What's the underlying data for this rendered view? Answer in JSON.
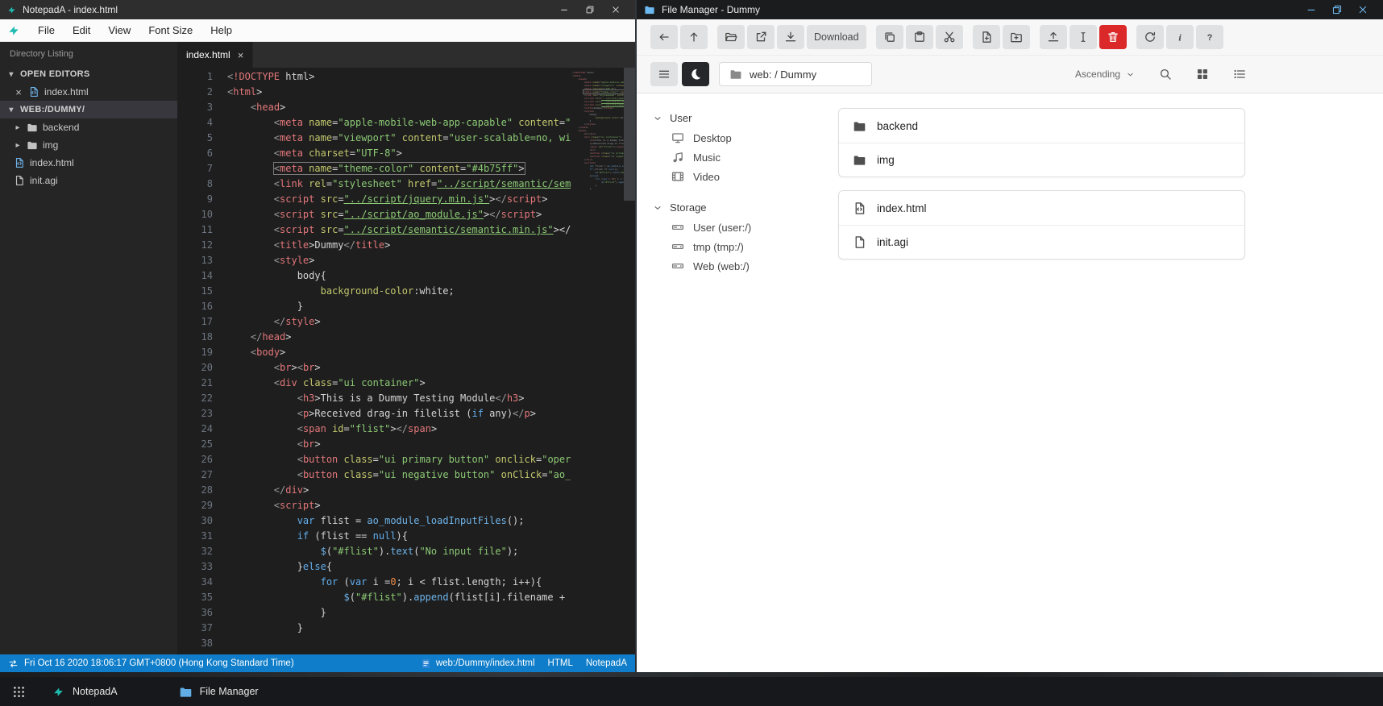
{
  "colors": {
    "accent_teal": "#1ebcb0",
    "statusbar_blue": "#0f7dc9",
    "danger_red": "#db2828",
    "fm_titlebar_dark": "#1b1c1d",
    "editor_bg": "#1e1e1e"
  },
  "notepada": {
    "window_title": "NotepadA - index.html",
    "menu": [
      "File",
      "Edit",
      "View",
      "Font Size",
      "Help"
    ],
    "sidebar": {
      "title": "Directory Listing",
      "sections": [
        {
          "label": "OPEN EDITORS",
          "active": false,
          "items": [
            {
              "name": "index.html",
              "icon": "file-code",
              "closable": true
            }
          ]
        },
        {
          "label": "WEB:/DUMMY/",
          "active": true,
          "items": [
            {
              "name": "backend",
              "icon": "folder-fill",
              "chevron": true
            },
            {
              "name": "img",
              "icon": "folder-fill",
              "chevron": true
            },
            {
              "name": "index.html",
              "icon": "file-code"
            },
            {
              "name": "init.agi",
              "icon": "file"
            }
          ]
        }
      ]
    },
    "tab": {
      "name": "index.html"
    },
    "editor": {
      "highlight_line": 7,
      "lines": [
        "<!DOCTYPE html>",
        "<html>",
        "    <head>",
        "        <meta name=\"apple-mobile-web-app-capable\" content=\"",
        "        <meta name=\"viewport\" content=\"user-scalable=no, wi",
        "        <meta charset=\"UTF-8\">",
        "        <meta name=\"theme-color\" content=\"#4b75ff\">",
        "        <link rel=\"stylesheet\" href=\"../script/semantic/sem",
        "        <script src=\"../script/jquery.min.js\"></script>",
        "        <script src=\"../script/ao_module.js\"></script>",
        "        <script src=\"../script/semantic/semantic.min.js\"></",
        "        <title>Dummy</title>",
        "        <style>",
        "            body{",
        "                background-color:white;",
        "            }",
        "        </style>",
        "    </head>",
        "    <body>",
        "        <br><br>",
        "        <div class=\"ui container\">",
        "            <h3>This is a Dummy Testing Module</h3>",
        "            <p>Received drag-in filelist (if any)</p>",
        "            <span id=\"flist\"></span>",
        "            <br>",
        "            <button class=\"ui primary button\" onclick=\"oper",
        "            <button class=\"ui negative button\" onClick=\"ao_",
        "        </div>",
        "        <script>",
        "            var flist = ao_module_loadInputFiles();",
        "            if (flist == null){",
        "                $(\"#flist\").text(\"No input file\");",
        "            }else{",
        "                for (var i =0; i < flist.length; i++){",
        "                    $(\"#flist\").append(flist[i].filename + ",
        "                }",
        "            }",
        ""
      ]
    },
    "statusbar": {
      "time": "Fri Oct 16 2020 18:06:17 GMT+0800 (Hong Kong Standard Time)",
      "path": "web:/Dummy/index.html",
      "language": "HTML",
      "app": "NotepadA"
    }
  },
  "filemanager": {
    "window_title": "File Manager - Dummy",
    "toolbar_groups": [
      {
        "buttons": [
          {
            "name": "back",
            "icon": "arrow-left"
          },
          {
            "name": "up",
            "icon": "arrow-up"
          }
        ]
      },
      {
        "buttons": [
          {
            "name": "open",
            "icon": "folder-open"
          },
          {
            "name": "open-in-new-window",
            "icon": "external"
          },
          {
            "name": "download-file",
            "icon": "download"
          },
          {
            "name": "download",
            "label": "Download"
          }
        ]
      },
      {
        "buttons": [
          {
            "name": "copy",
            "icon": "copy"
          },
          {
            "name": "paste",
            "icon": "paste"
          },
          {
            "name": "cut",
            "icon": "cut"
          }
        ]
      },
      {
        "buttons": [
          {
            "name": "new-file",
            "icon": "new-file"
          },
          {
            "name": "new-folder",
            "icon": "new-folder"
          }
        ]
      },
      {
        "buttons": [
          {
            "name": "upload",
            "icon": "upload"
          },
          {
            "name": "rename",
            "icon": "i-cursor"
          },
          {
            "name": "delete",
            "icon": "trash",
            "style": "danger"
          }
        ]
      },
      {
        "buttons": [
          {
            "name": "refresh",
            "icon": "refresh"
          },
          {
            "name": "properties",
            "icon": "info"
          },
          {
            "name": "help",
            "icon": "help"
          }
        ]
      }
    ],
    "pathbar": {
      "path": "web: / Dummy",
      "sort": "Ascending"
    },
    "sidebar_sections": [
      {
        "label": "User",
        "items": [
          {
            "name": "Desktop",
            "icon": "monitor"
          },
          {
            "name": "Music",
            "icon": "music"
          },
          {
            "name": "Video",
            "icon": "film"
          }
        ]
      },
      {
        "label": "Storage",
        "items": [
          {
            "name": "User (user:/)",
            "icon": "disk"
          },
          {
            "name": "tmp (tmp:/)",
            "icon": "disk"
          },
          {
            "name": "Web (web:/)",
            "icon": "disk"
          }
        ]
      }
    ],
    "file_groups": [
      {
        "items": [
          {
            "name": "backend",
            "icon": "folder-fill"
          },
          {
            "name": "img",
            "icon": "folder-fill"
          }
        ]
      },
      {
        "items": [
          {
            "name": "index.html",
            "icon": "file-code"
          },
          {
            "name": "init.agi",
            "icon": "file"
          }
        ]
      }
    ]
  },
  "taskbar": {
    "apps_button": {
      "icon": "apps"
    },
    "items": [
      {
        "name": "NotepadA",
        "icon": "logo"
      },
      {
        "name": "File Manager",
        "icon": "folder-fill"
      }
    ]
  }
}
